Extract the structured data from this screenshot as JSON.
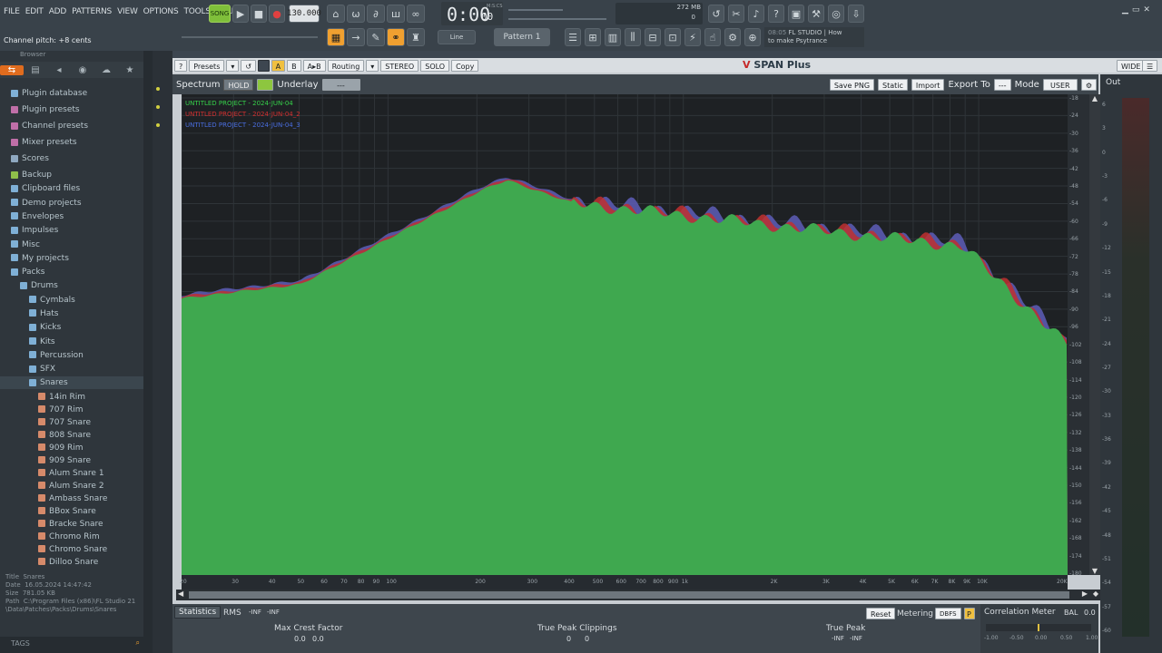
{
  "menu": [
    "FILE",
    "EDIT",
    "ADD",
    "PATTERNS",
    "VIEW",
    "OPTIONS",
    "TOOLS",
    "HELP"
  ],
  "transport": {
    "song_label": "SONG",
    "tempo": "130.000",
    "time": "0:00",
    "time_small": "00",
    "time_unit": "M:S:CS",
    "cpu": "272 MB",
    "cpu_voices": "0",
    "pattern": "Pattern 1",
    "line_mode": "Line"
  },
  "news": {
    "time": "08:05",
    "line1": "FL STUDIO | How",
    "line2": "to make Psytrance"
  },
  "status": "Channel pitch: +8 cents",
  "browser": {
    "header": "Browser",
    "items": [
      {
        "label": "Plugin database",
        "indent": 0
      },
      {
        "label": "Plugin presets",
        "indent": 0
      },
      {
        "label": "Channel presets",
        "indent": 0
      },
      {
        "label": "Mixer presets",
        "indent": 0
      },
      {
        "label": "Scores",
        "indent": 0
      },
      {
        "label": "Backup",
        "indent": 0
      },
      {
        "label": "Clipboard files",
        "indent": 0
      },
      {
        "label": "Demo projects",
        "indent": 0
      },
      {
        "label": "Envelopes",
        "indent": 0
      },
      {
        "label": "Impulses",
        "indent": 0
      },
      {
        "label": "Misc",
        "indent": 0
      },
      {
        "label": "My projects",
        "indent": 0
      },
      {
        "label": "Packs",
        "indent": 0
      },
      {
        "label": "Drums",
        "indent": 1
      },
      {
        "label": "Cymbals",
        "indent": 2
      },
      {
        "label": "Hats",
        "indent": 2
      },
      {
        "label": "Kicks",
        "indent": 2
      },
      {
        "label": "Kits",
        "indent": 2
      },
      {
        "label": "Percussion",
        "indent": 2
      },
      {
        "label": "SFX",
        "indent": 2
      },
      {
        "label": "Snares",
        "indent": 2
      },
      {
        "label": "14in Rim",
        "indent": 3
      },
      {
        "label": "707 Rim",
        "indent": 3
      },
      {
        "label": "707 Snare",
        "indent": 3
      },
      {
        "label": "808 Snare",
        "indent": 3
      },
      {
        "label": "909 Rim",
        "indent": 3
      },
      {
        "label": "909 Snare",
        "indent": 3
      },
      {
        "label": "Alum Snare 1",
        "indent": 3
      },
      {
        "label": "Alum Snare 2",
        "indent": 3
      },
      {
        "label": "Ambass Snare",
        "indent": 3
      },
      {
        "label": "BBox Snare",
        "indent": 3
      },
      {
        "label": "Bracke Snare",
        "indent": 3
      },
      {
        "label": "Chromo Rim",
        "indent": 3
      },
      {
        "label": "Chromo Snare",
        "indent": 3
      },
      {
        "label": "Dilloo Snare",
        "indent": 3
      }
    ],
    "info": {
      "title_k": "Title",
      "title_v": "Snares",
      "date_k": "Date",
      "date_v": "16.05.2024 14:47:42",
      "size_k": "Size",
      "size_v": "781.05 KB",
      "path_k": "Path",
      "path_v": "C:\\Program Files (x86)\\FL Studio 21\\Data\\Patches\\Packs\\Drums\\Snares"
    },
    "tags": "TAGS"
  },
  "plugin": {
    "title": "SPAN Plus",
    "wide": "WIDE",
    "toolbar": [
      "?",
      "Presets",
      "A",
      "B",
      "A▸B",
      "Routing",
      "STEREO",
      "SOLO",
      "Copy"
    ],
    "spectrum_label": "Spectrum",
    "hold": "HOLD",
    "underlay": "Underlay",
    "underlay_val": "---",
    "buttons": {
      "save": "Save PNG",
      "static": "Static",
      "import": "Import",
      "export": "Export To",
      "export_val": "---",
      "mode": "Mode",
      "mode_val": "USER"
    },
    "out": "Out",
    "legend": [
      {
        "label": "UNTITLED PROJECT - 2024-JUN-04",
        "color": "#36d24a"
      },
      {
        "label": "UNTITLED PROJECT - 2024-JUN-04_2",
        "color": "#d43030"
      },
      {
        "label": "UNTITLED PROJECT - 2024-JUN-04_3",
        "color": "#4a6ee0"
      }
    ],
    "x_ticks": [
      "20",
      "30",
      "40",
      "50",
      "60",
      "70",
      "80",
      "90",
      "100",
      "200",
      "300",
      "400",
      "500",
      "600",
      "700",
      "800",
      "900",
      "1k",
      "2K",
      "3K",
      "4K",
      "5K",
      "6K",
      "7K",
      "8K",
      "9K",
      "10K",
      "20K"
    ],
    "y_ticks": [
      "-18",
      "-24",
      "-30",
      "-36",
      "-42",
      "-48",
      "-54",
      "-60",
      "-66",
      "-72",
      "-78",
      "-84",
      "-90",
      "-96",
      "-102",
      "-108",
      "-114",
      "-120",
      "-126",
      "-132",
      "-138",
      "-144",
      "-150",
      "-156",
      "-162",
      "-168",
      "-174",
      "-180"
    ],
    "meter_ticks": [
      "6",
      "3",
      "0",
      "-3",
      "-6",
      "-9",
      "-12",
      "-15",
      "-18",
      "-21",
      "-24",
      "-27",
      "-30",
      "-33",
      "-36",
      "-39",
      "-42",
      "-45",
      "-48",
      "-51",
      "-54",
      "-57",
      "-60"
    ],
    "stats": {
      "label": "Statistics",
      "rms": "RMS",
      "rms_v1": "-INF",
      "rms_v2": "-INF",
      "crest": "Max Crest Factor",
      "crest_v1": "0.0",
      "crest_v2": "0.0",
      "clip": "True Peak Clippings",
      "clip_v1": "0",
      "clip_v2": "0",
      "peak": "True Peak",
      "peak_v1": "-INF",
      "peak_v2": "-INF",
      "reset": "Reset",
      "metering": "Metering",
      "metering_val": "DBFS"
    },
    "corr": {
      "label": "Correlation Meter",
      "bal": "BAL",
      "bal_v": "0.0",
      "scale": [
        "-1.00",
        "-0.50",
        "0.00",
        "0.50",
        "1.00"
      ]
    }
  }
}
